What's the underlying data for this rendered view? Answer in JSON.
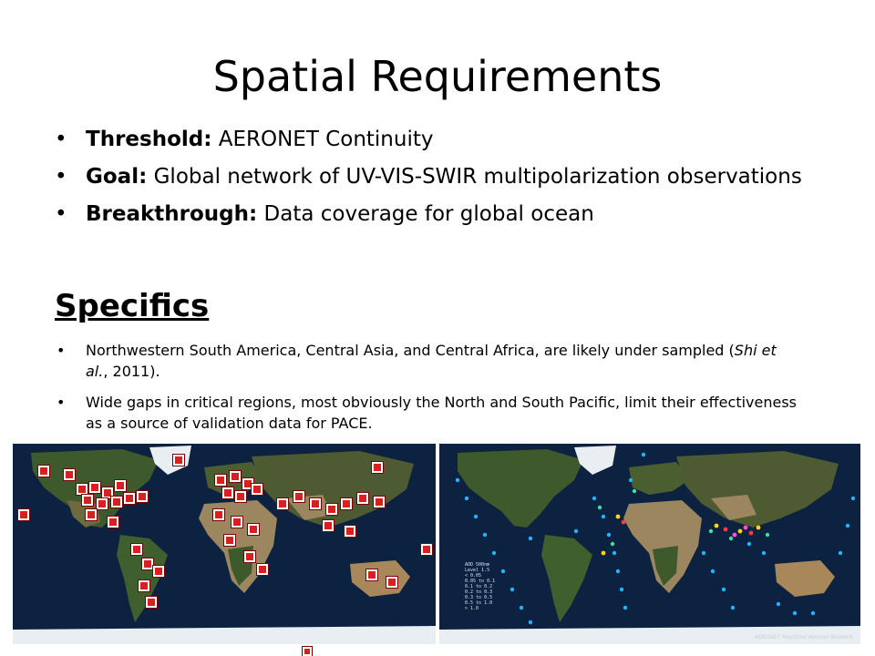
{
  "slide": {
    "title": "Spatial Requirements",
    "bullets": [
      {
        "label": "Threshold:",
        "text": "  AERONET Continuity"
      },
      {
        "label": "Goal:",
        "text": " Global network of UV-VIS-SWIR multipolarization observations"
      },
      {
        "label": "Breakthrough:",
        "text": " Data coverage for global ocean"
      }
    ],
    "specifics_heading": "Specifics",
    "specifics": [
      {
        "before": "Northwestern South America, Central Asia, and Central Africa, are likely under sampled (",
        "italic": "Shi et al.",
        "after": ", 2011)."
      },
      {
        "text": "Wide gaps in critical regions, most obviously the North and South Pacific, limit their effectiveness as a source of validation data for PACE."
      }
    ]
  },
  "maps": {
    "right_caption": "AERONET Maritime Aerosol Network",
    "legend": [
      "AOD 500nm",
      "Level 1.5",
      "< 0.05",
      "0.05 to 0.1",
      "0.1 to 0.2",
      "0.2 to 0.3",
      "0.3 to 0.5",
      "0.5 to 1.0",
      "> 1.0"
    ]
  },
  "colors": {
    "ocean": "#0d2240",
    "land_green": "#3e5a2c",
    "desert": "#9b8660",
    "ice": "#e8eef2",
    "marker_red": "#d82020",
    "marker_border": "#ffffff"
  }
}
